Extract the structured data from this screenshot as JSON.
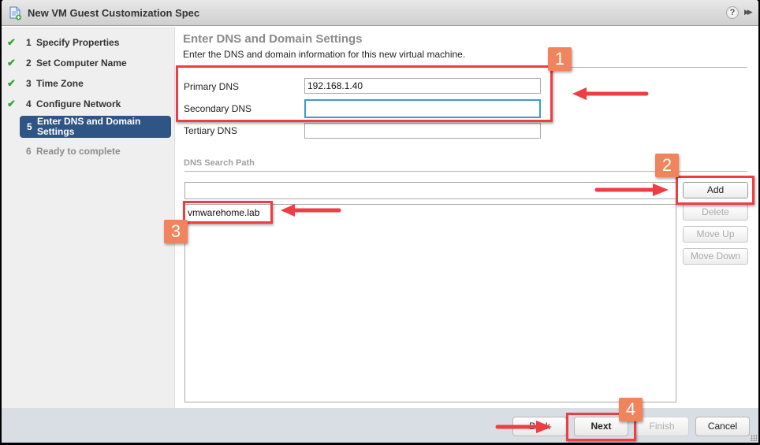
{
  "window": {
    "title": "New VM Guest Customization Spec",
    "icons": {
      "app": "document-add-icon",
      "help": "help-icon",
      "expand": "double-chevron-right-icon"
    },
    "help_glyph": "?",
    "expand_glyph": "▶▶"
  },
  "sidebar": {
    "steps": [
      {
        "num": "1",
        "label": "Specify Properties",
        "state": "complete"
      },
      {
        "num": "2",
        "label": "Set Computer Name",
        "state": "complete"
      },
      {
        "num": "3",
        "label": "Time Zone",
        "state": "complete"
      },
      {
        "num": "4",
        "label": "Configure Network",
        "state": "complete"
      },
      {
        "num": "5",
        "label": "Enter DNS and Domain Settings",
        "state": "active"
      },
      {
        "num": "6",
        "label": "Ready to complete",
        "state": "pending"
      }
    ],
    "check_glyph": "✔"
  },
  "main": {
    "title": "Enter DNS and Domain Settings",
    "description": "Enter the DNS and domain information for this new virtual machine.",
    "fields": {
      "primary_dns": {
        "label": "Primary DNS",
        "value": "192.168.1.40"
      },
      "secondary_dns": {
        "label": "Secondary DNS",
        "value": ""
      },
      "tertiary_dns": {
        "label": "Tertiary DNS",
        "value": ""
      }
    },
    "search_path": {
      "section_label": "DNS Search Path",
      "input_value": "",
      "items": [
        "vmwarehome.lab"
      ],
      "buttons": {
        "add": "Add",
        "delete": "Delete",
        "move_up": "Move Up",
        "move_down": "Move Down"
      }
    }
  },
  "footer": {
    "back": "Back",
    "next": "Next",
    "finish": "Finish",
    "cancel": "Cancel"
  },
  "annotations": {
    "color": "#ee3e44",
    "badge_color": "#f0845c",
    "badges": [
      "1",
      "2",
      "3",
      "4"
    ]
  },
  "colors": {
    "active_step": "#2e5583",
    "check": "#35a335",
    "focus_border": "#3f9bcd",
    "footer_bg": "#d9dde4"
  }
}
